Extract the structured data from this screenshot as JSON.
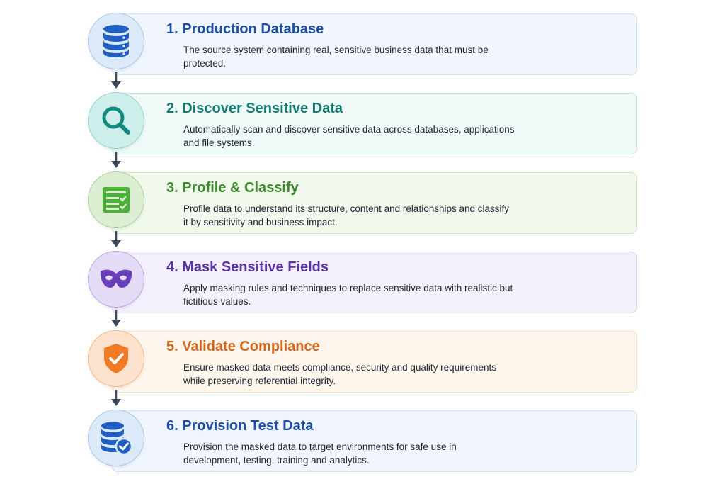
{
  "steps": [
    {
      "title": "1. Production Database",
      "description": "The source system containing real, sensitive business data that must be protected.",
      "icon": "database-icon",
      "theme": "#1c4ea6"
    },
    {
      "title": "2. Discover Sensitive Data",
      "description": "Automatically scan and discover sensitive data across databases, applications and file systems.",
      "icon": "magnifier-icon",
      "theme": "#137d74"
    },
    {
      "title": "3. Profile & Classify",
      "description": "Profile data to understand its structure, content and relationships and classify it by sensitivity and business impact.",
      "icon": "checklist-icon",
      "theme": "#3e8b2f"
    },
    {
      "title": "4. Mask Sensitive Fields",
      "description": "Apply masking rules and techniques to replace sensitive data with realistic but fictitious values.",
      "icon": "mask-icon",
      "theme": "#5b32a4"
    },
    {
      "title": "5. Validate Compliance",
      "description": "Ensure masked data meets compliance, security and quality requirements while preserving referential integrity.",
      "icon": "shield-check-icon",
      "theme": "#d4661a"
    },
    {
      "title": "6. Provision Test Data",
      "description": "Provision the masked data to target environments for safe use in development, testing, training and analytics.",
      "icon": "database-check-icon",
      "theme": "#1c4ea6"
    }
  ]
}
